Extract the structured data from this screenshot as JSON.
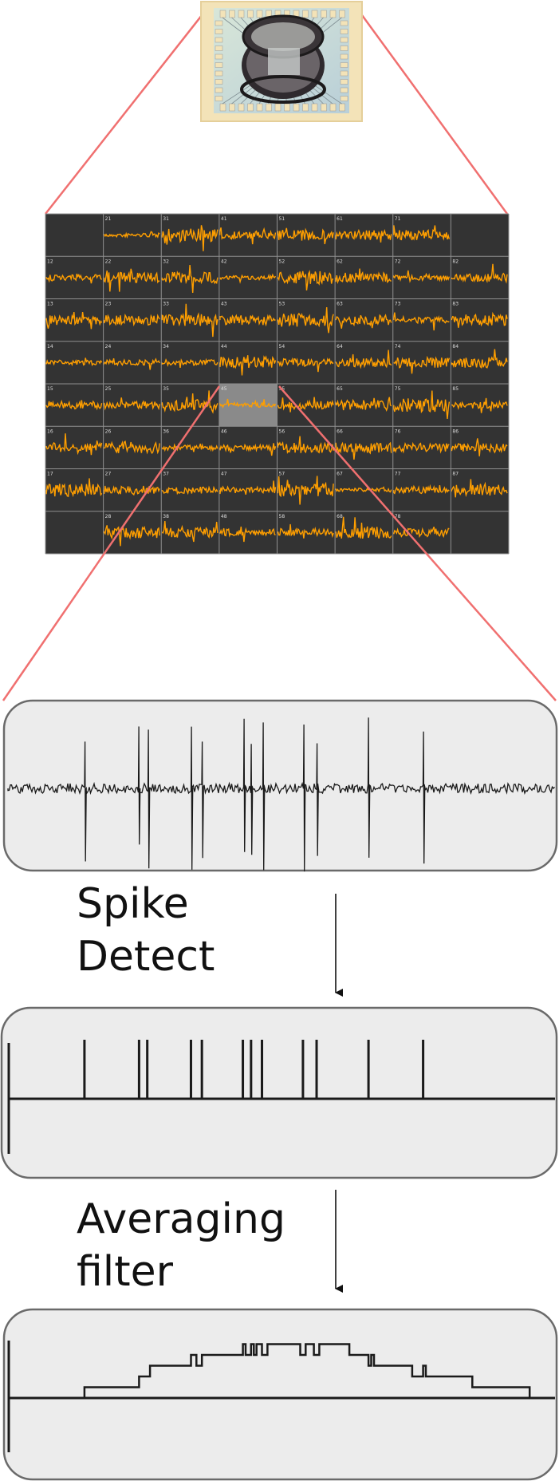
{
  "figure": {
    "steps": [
      {
        "id": "spike",
        "label_line1": "Spike",
        "label_line2": "Detect"
      },
      {
        "id": "avg",
        "label_line1": "Averaging",
        "label_line2": "filter"
      }
    ]
  },
  "mea_grid": {
    "columns": 8,
    "rows": 8,
    "highlighted_channel": {
      "row": 5,
      "col": 4
    },
    "channel_labels": [
      [
        "",
        "21",
        "31",
        "41",
        "51",
        "61",
        "71",
        ""
      ],
      [
        "12",
        "22",
        "32",
        "42",
        "52",
        "62",
        "72",
        "82"
      ],
      [
        "13",
        "23",
        "33",
        "43",
        "53",
        "63",
        "73",
        "83"
      ],
      [
        "14",
        "24",
        "34",
        "44",
        "54",
        "64",
        "74",
        "84"
      ],
      [
        "15",
        "25",
        "35",
        "45",
        "55",
        "65",
        "75",
        "85"
      ],
      [
        "16",
        "26",
        "36",
        "46",
        "56",
        "66",
        "76",
        "86"
      ],
      [
        "17",
        "27",
        "37",
        "47",
        "57",
        "67",
        "77",
        "87"
      ],
      [
        "",
        "28",
        "38",
        "48",
        "58",
        "68",
        "78",
        ""
      ]
    ],
    "corner_empty": [
      [
        1,
        1
      ],
      [
        1,
        8
      ],
      [
        8,
        1
      ],
      [
        8,
        8
      ]
    ]
  },
  "spike_times": [
    0.14,
    0.24,
    0.255,
    0.335,
    0.355,
    0.43,
    0.445,
    0.465,
    0.54,
    0.565,
    0.66,
    0.76
  ],
  "averaging_filter_levels": [
    {
      "start": 0.14,
      "end": 0.24,
      "level": 1
    },
    {
      "start": 0.24,
      "end": 0.26,
      "level": 2
    },
    {
      "start": 0.26,
      "end": 0.335,
      "level": 3
    },
    {
      "start": 0.335,
      "end": 0.345,
      "level": 4
    },
    {
      "start": 0.345,
      "end": 0.355,
      "level": 3
    },
    {
      "start": 0.355,
      "end": 0.43,
      "level": 4
    },
    {
      "start": 0.43,
      "end": 0.435,
      "level": 5
    },
    {
      "start": 0.435,
      "end": 0.445,
      "level": 4
    },
    {
      "start": 0.445,
      "end": 0.45,
      "level": 5
    },
    {
      "start": 0.45,
      "end": 0.455,
      "level": 4
    },
    {
      "start": 0.455,
      "end": 0.465,
      "level": 5
    },
    {
      "start": 0.465,
      "end": 0.475,
      "level": 4
    },
    {
      "start": 0.475,
      "end": 0.535,
      "level": 5
    },
    {
      "start": 0.535,
      "end": 0.545,
      "level": 4
    },
    {
      "start": 0.545,
      "end": 0.56,
      "level": 5
    },
    {
      "start": 0.56,
      "end": 0.57,
      "level": 4
    },
    {
      "start": 0.57,
      "end": 0.625,
      "level": 5
    },
    {
      "start": 0.625,
      "end": 0.66,
      "level": 4
    },
    {
      "start": 0.66,
      "end": 0.665,
      "level": 3
    },
    {
      "start": 0.665,
      "end": 0.67,
      "level": 4
    },
    {
      "start": 0.67,
      "end": 0.74,
      "level": 3
    },
    {
      "start": 0.74,
      "end": 0.76,
      "level": 2
    },
    {
      "start": 0.76,
      "end": 0.765,
      "level": 3
    },
    {
      "start": 0.765,
      "end": 0.85,
      "level": 2
    },
    {
      "start": 0.85,
      "end": 0.955,
      "level": 1
    }
  ],
  "colors": {
    "zoom_line": "#f07070",
    "panel_fill": "#ececec",
    "panel_stroke": "#6a6a6a",
    "trace": "#1a1a1a",
    "mea_bg": "#333333",
    "mea_grid_line": "#8f8f8f",
    "mea_trace": "#ff9f00",
    "highlight": "#8a8a8a"
  }
}
